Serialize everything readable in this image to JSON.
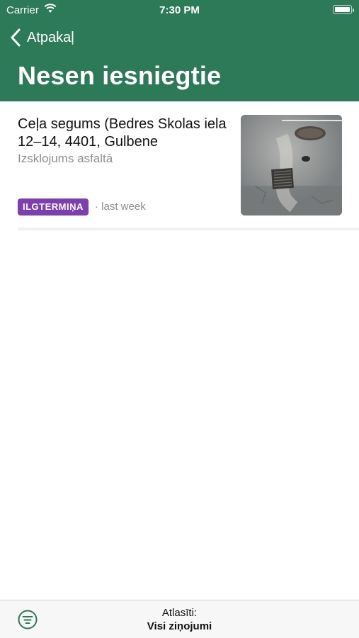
{
  "status_bar": {
    "carrier": "Carrier",
    "time": "7:30 PM"
  },
  "nav": {
    "back_label": "Atpakaļ",
    "title": "Nesen iesniegtie"
  },
  "report": {
    "headline": "Ceļa segums (Bedres Skolas iela 12–14, 4401, Gulbene",
    "subtitle": "Izsklojums asfaltā",
    "badge": "ILGTERMIŅA",
    "time_ago": "· last week",
    "thumbnail_icon": "road-photo"
  },
  "toolbar": {
    "filter_label": "Atlasīti:",
    "filter_value": "Visi ziņojumi",
    "filter_icon": "filter-icon"
  },
  "colors": {
    "header": "#2c7a57",
    "badge": "#7d3fb0",
    "accent": "#2c7a57"
  }
}
